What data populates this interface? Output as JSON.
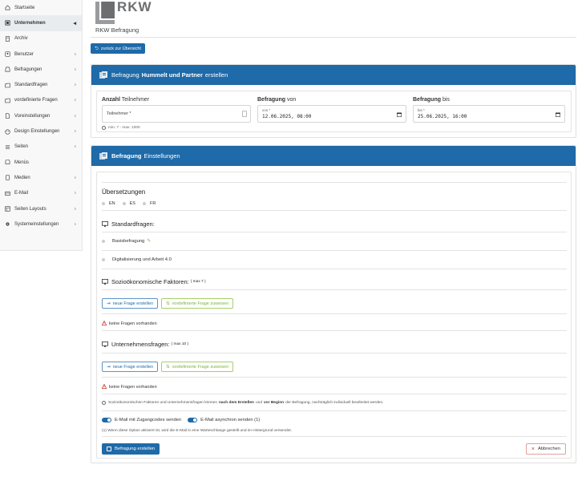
{
  "sidebar": {
    "items": [
      {
        "label": "Startseite",
        "icon": "home-icon",
        "chevron": false,
        "active": false
      },
      {
        "label": "Unternehmen",
        "icon": "building-icon",
        "chevron": true,
        "active": true
      },
      {
        "label": "Archiv",
        "icon": "archive-icon",
        "chevron": false,
        "active": false
      },
      {
        "label": "Benutzer",
        "icon": "user-icon",
        "chevron": true,
        "active": false
      },
      {
        "label": "Befragungen",
        "icon": "inbox-icon",
        "chevron": true,
        "active": false
      },
      {
        "label": "Standardfragen",
        "icon": "folder-icon",
        "chevron": true,
        "active": false
      },
      {
        "label": "vordefinierte Fragen",
        "icon": "folder-icon",
        "chevron": true,
        "active": false
      },
      {
        "label": "Voreinstellungen",
        "icon": "file-icon",
        "chevron": true,
        "active": false
      },
      {
        "label": "Design Einstellungen",
        "icon": "palette-icon",
        "chevron": true,
        "active": false
      },
      {
        "label": "Seiten",
        "icon": "pages-icon",
        "chevron": true,
        "active": false
      },
      {
        "label": "Menüs",
        "icon": "menu-icon",
        "chevron": false,
        "active": false
      },
      {
        "label": "Medien",
        "icon": "media-icon",
        "chevron": true,
        "active": false
      },
      {
        "label": "E-Mail",
        "icon": "mail-icon",
        "chevron": true,
        "active": false
      },
      {
        "label": "Seiten Layouts",
        "icon": "layout-icon",
        "chevron": true,
        "active": false
      },
      {
        "label": "Systemeinstellungen",
        "icon": "gear-icon",
        "chevron": true,
        "active": false
      }
    ]
  },
  "header": {
    "logo_text": "RKW",
    "app_title": "RKW Befragung",
    "back_label": "zurück zur Übersicht"
  },
  "create_card": {
    "title_prefix": "Befragung",
    "company": "Hummelt und Partner",
    "title_suffix": "erstellen",
    "participants": {
      "label_bold": "Anzahl",
      "label_rest": "Teilnehmer",
      "placeholder": "Teilnehmer *",
      "hint": "min: 7 - max: 1000"
    },
    "date_from": {
      "label_bold": "Befragung",
      "label_rest": "von",
      "small_label": "von *",
      "value": "12.06.2025, 08:00"
    },
    "date_to": {
      "label_bold": "Befragung",
      "label_rest": "bis",
      "small_label": "bis *",
      "value": "25.06.2025, 16:00"
    }
  },
  "settings_card": {
    "title_bold": "Befragung",
    "title_rest": "Einstellungen",
    "translations_title": "Übersetzungen",
    "languages": [
      "EN",
      "ES",
      "FR"
    ],
    "standard_title": "Standardfragen:",
    "standard_questions": [
      "Basisbefragung",
      "Digitalisierung und Arbeit 4.0"
    ],
    "socio_title": "Sozioökonomische Faktoren:",
    "socio_max": "( max 7 )",
    "company_title": "Unternehmensfragen:",
    "company_max": "( max 10 )",
    "new_question_label": "neue Frage erstellen",
    "assign_predefined_label": "vordefinierte Frage zuweisen",
    "no_questions": "keine Fragen vorhanden",
    "note_part1": "Sozioökonomischen Faktoren und Unternehmensfragen können",
    "note_bold1": "nach dem Erstellen",
    "note_part2": "und",
    "note_bold2": "vor Beginn",
    "note_part3": "der Befragung, nachträglich individuell bearbeitet werden.",
    "toggle1_label": "E-Mail mit Zugangcodes senden",
    "toggle2_label": "E-Mail asynchron senden (1)",
    "async_note": "(1) Wenn diese Option aktiviert ist, wird die E-Mail in eine Warteschlange gestellt und im Hintergrund versendet.",
    "create_label": "Befragung erstellen",
    "cancel_label": "Abbrechen"
  },
  "colors": {
    "primary": "#1f6aa8",
    "success_outline": "#7cb342",
    "danger": "#c0392b"
  }
}
